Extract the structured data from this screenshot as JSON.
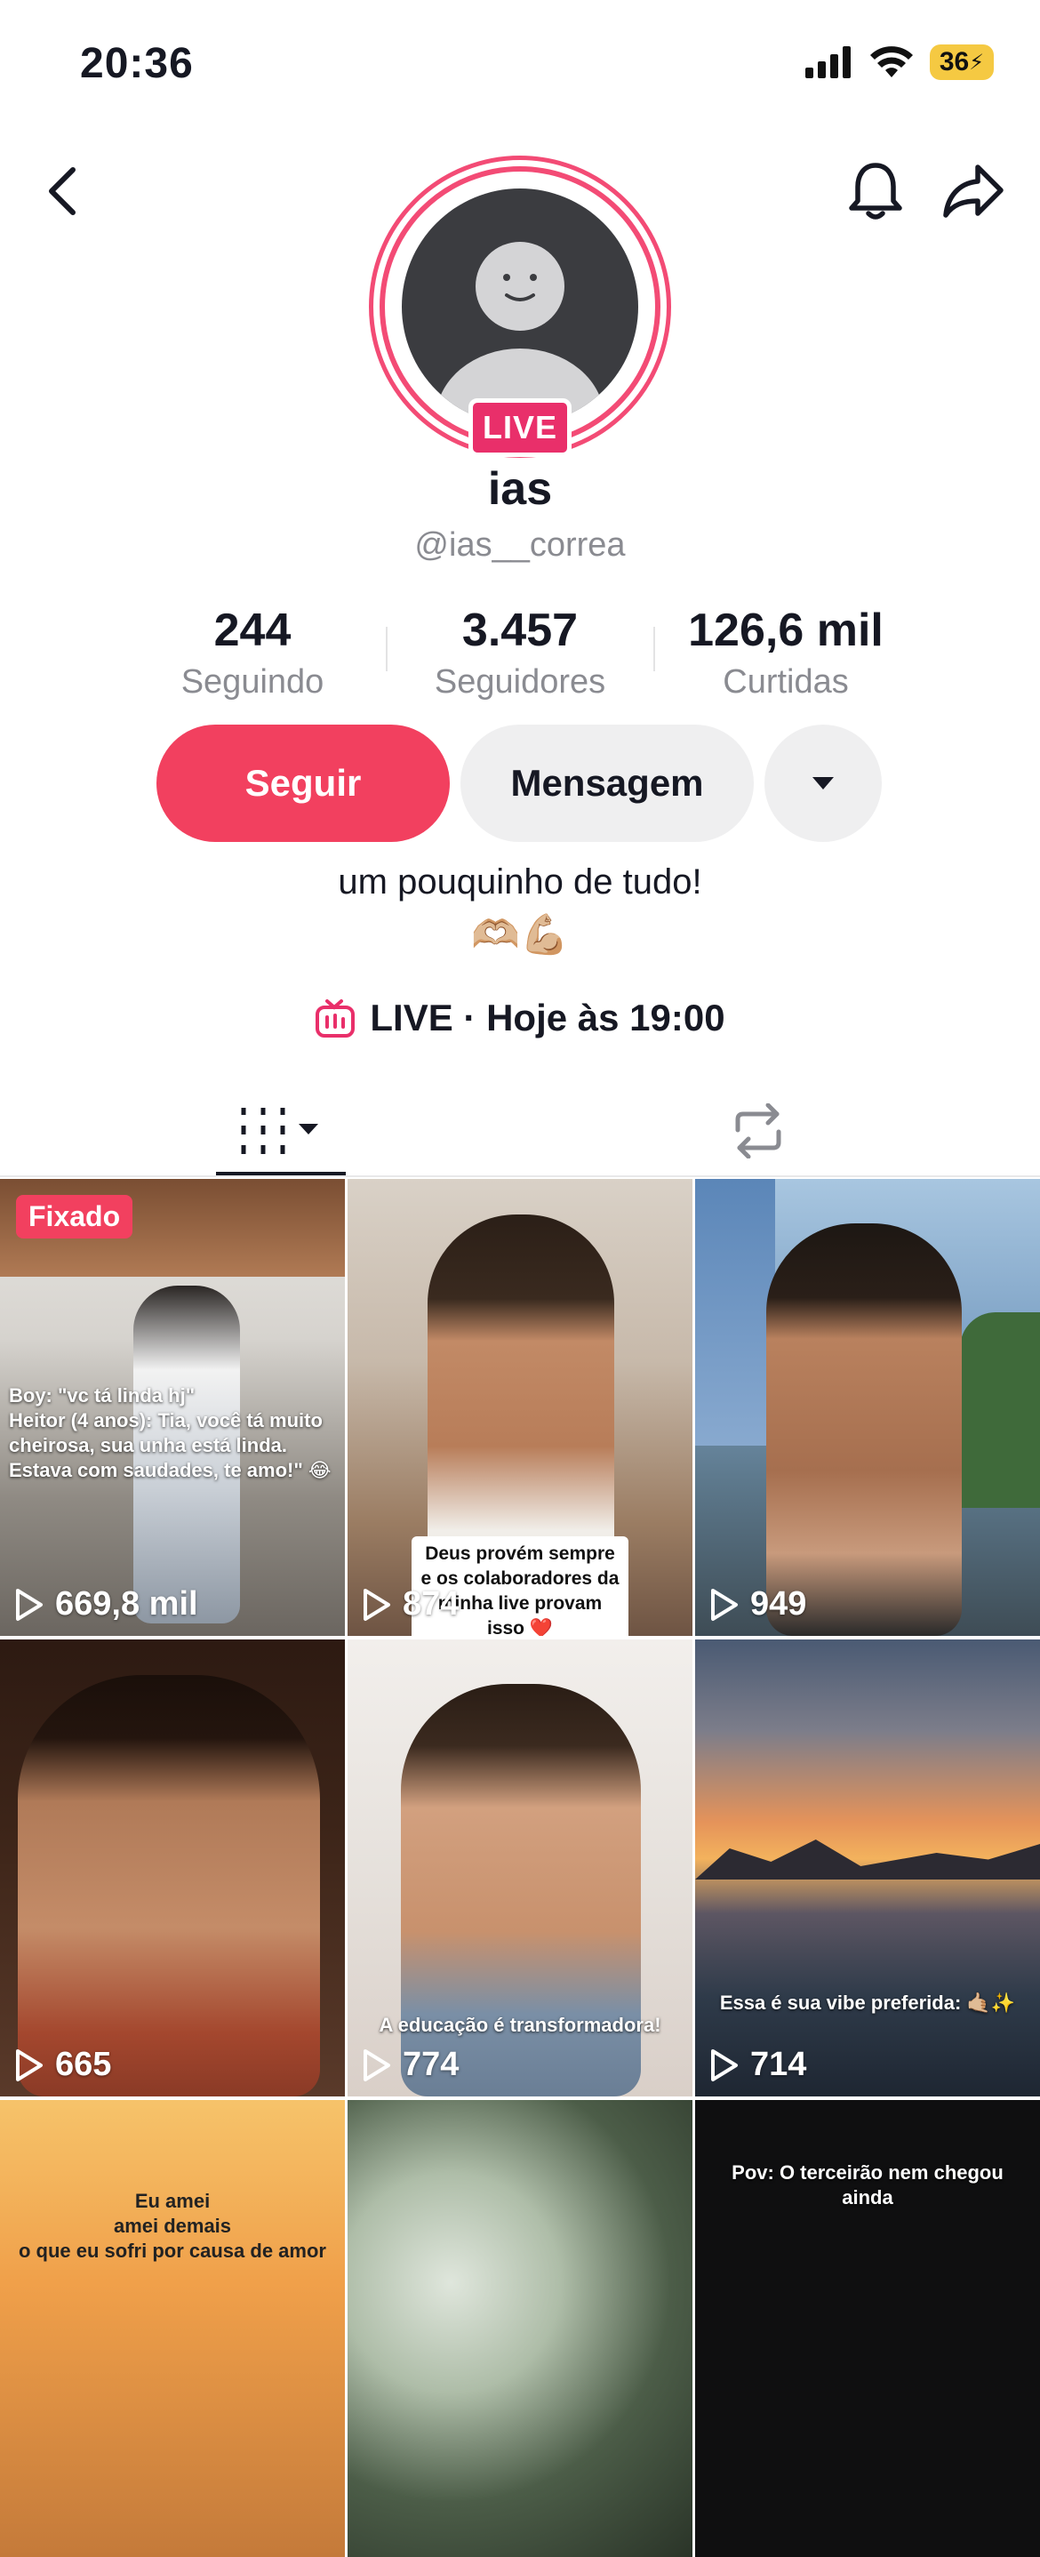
{
  "status_bar": {
    "time": "20:36",
    "battery": "36"
  },
  "profile": {
    "live_badge": "LIVE",
    "display_name": "ias",
    "username": "@ias__correa",
    "stats": [
      {
        "value": "244",
        "label": "Seguindo"
      },
      {
        "value": "3.457",
        "label": "Seguidores"
      },
      {
        "value": "126,6 mil",
        "label": "Curtidas"
      }
    ],
    "follow_label": "Seguir",
    "message_label": "Mensagem",
    "bio": "um pouquinho de tudo!",
    "bio_emoji": "🫶🏼💪🏼",
    "live_schedule": "LIVE · Hoje às 19:00"
  },
  "colors": {
    "accent": "#f2405f",
    "live": "#e92f6a",
    "secondary_text": "#8a8b91"
  },
  "tabs": [
    {
      "icon": "grid-icon",
      "active": true
    },
    {
      "icon": "repost-icon",
      "active": false
    }
  ],
  "videos": [
    {
      "views": "669,8 mil",
      "pinned_label": "Fixado",
      "text": "Boy: \"vc tá linda hj\"\nHeitor (4 anos): Tia, você tá muito cheirosa, sua unha está linda. Estava com saudades, te amo!\" 😂"
    },
    {
      "views": "874",
      "text": "Deus provém sempre e os colaboradores da minha live provam isso ❤️"
    },
    {
      "views": "949",
      "text": ""
    },
    {
      "views": "665",
      "text": ""
    },
    {
      "views": "774",
      "text": "A educação é transformadora!"
    },
    {
      "views": "714",
      "text": "Essa é sua vibe preferida: 🤙🏼✨"
    },
    {
      "views": "",
      "text": "Eu amei\namei demais\no que eu sofri por causa de amor"
    },
    {
      "views": "",
      "text": ""
    },
    {
      "views": "",
      "text": "Pov: O terceirão nem chegou ainda"
    }
  ]
}
